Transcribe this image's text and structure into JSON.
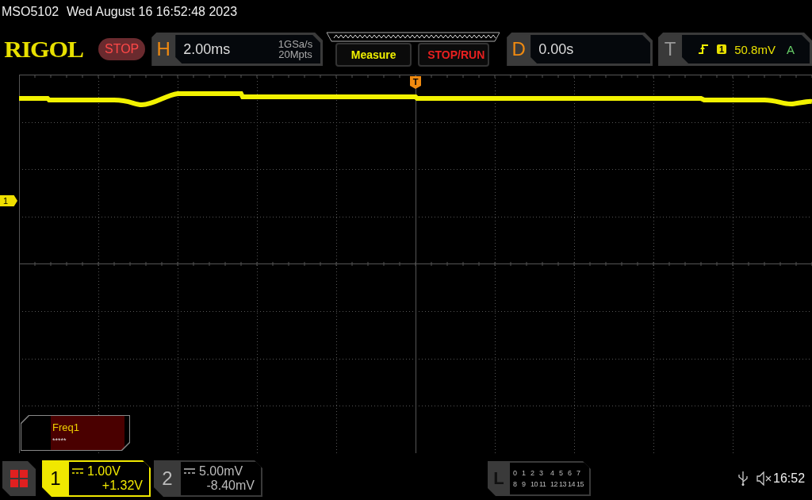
{
  "status_line": {
    "model": "MSO5102",
    "datetime": "Wed August 16 16:52:48 2023"
  },
  "toolbar": {
    "logo": "RIGOL",
    "run_state": "STOP",
    "horizontal": {
      "label": "H",
      "timebase": "2.00ms",
      "sample_rate": "1GSa/s",
      "memory_depth": "20Mpts"
    },
    "buttons": [
      {
        "label": "Measure",
        "kind": "menu"
      },
      {
        "label": "STOP/RUN",
        "kind": "run"
      }
    ],
    "delay": {
      "label": "D",
      "value": "0.00s"
    },
    "trigger": {
      "label": "T",
      "source": "1",
      "level": "50.8mV",
      "mode": "A"
    }
  },
  "trigger_marker": "T",
  "channel_marker": "1",
  "measurement": {
    "name": "Freq1",
    "value": "*****"
  },
  "channels": [
    {
      "number": "1",
      "scale": "1.00V",
      "offset": "+1.32V",
      "selected": true
    },
    {
      "number": "2",
      "scale": "5.00mV",
      "offset": "-8.40mV",
      "selected": false
    }
  ],
  "logic": {
    "label": "L",
    "rows": [
      [
        "0",
        "1",
        "2",
        "3",
        "4",
        "5",
        "6",
        "7"
      ],
      [
        "8",
        "9",
        "10",
        "11",
        "12",
        "13",
        "14",
        "15"
      ]
    ]
  },
  "clock": "16:52"
}
